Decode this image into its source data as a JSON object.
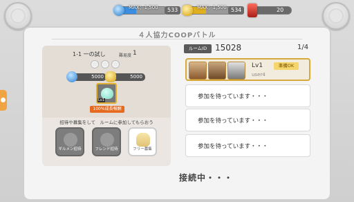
{
  "header": {
    "blue_resource": {
      "label": "MAX：1,500",
      "value": "533",
      "fill_fraction": 0.36,
      "color": "#3b8fe0"
    },
    "gold_resource": {
      "label": "MAX：1,500",
      "value": "534",
      "fill_fraction": 0.36,
      "color": "#e0b020"
    },
    "gem": {
      "value": "20",
      "color": "#c0302a"
    }
  },
  "title": "４人協力COOPバトル",
  "quest": {
    "name": "1-1 一の試し",
    "difficulty_label": "難易度",
    "difficulty": "1",
    "stars": [
      "☆",
      "☆",
      "☆"
    ],
    "reward_blue": "5000",
    "reward_gold": "5000",
    "unit_level": "Lv1",
    "rate_badge": "100%成長報酬",
    "invite_text": "招待や募集をして　ルームに参加してもらおう",
    "buttons": [
      {
        "label": "ギルメン招待"
      },
      {
        "label": "フレンド招待"
      },
      {
        "label": "フリー募集"
      }
    ]
  },
  "room": {
    "id_label": "ルームID",
    "id": "15028",
    "count": "1/4",
    "member": {
      "level": "Lv1",
      "user": "user4",
      "status": "準備OK"
    },
    "waiting": [
      "参加を待っています・・・",
      "参加を待っています・・・",
      "参加を待っています・・・"
    ]
  },
  "status": "接続中・・・"
}
